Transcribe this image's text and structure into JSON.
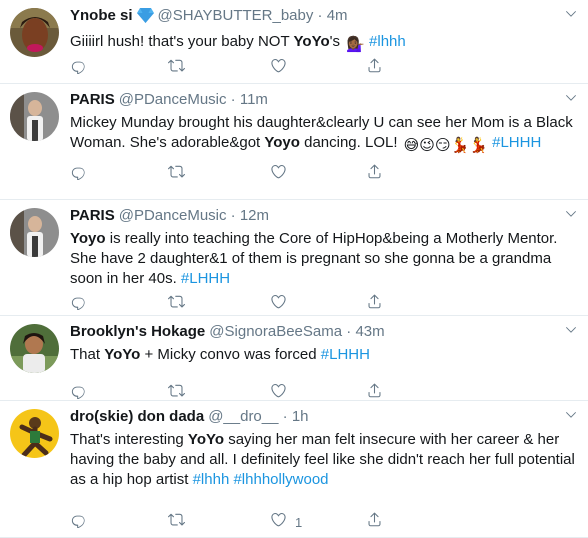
{
  "tweets": [
    {
      "name": "Ynobe si",
      "verified_badge": "diamond-emoji",
      "handle": "@SHAYBUTTER_baby",
      "dot": "·",
      "time": "4m",
      "text_parts": [
        {
          "t": "Giiiirl hush! that's your baby NOT "
        },
        {
          "t": "YoYo",
          "style": "bold"
        },
        {
          "t": "'s "
        },
        {
          "t": "💁🏾‍♀️",
          "style": "emoji",
          "icon": "woman-tipping-hand-emoji"
        },
        {
          "t": " "
        },
        {
          "t": "#lhhh",
          "style": "hashtag"
        }
      ],
      "like_count": ""
    },
    {
      "name": "PARIS",
      "handle": "@PDanceMusic",
      "dot": "·",
      "time": "11m",
      "text_parts": [
        {
          "t": "Mickey Munday brought his daughter&clearly U can see her Mom is a Black Woman. She's adorable&got "
        },
        {
          "t": "Yoyo",
          "style": "bold"
        },
        {
          "t": " dancing. LOL! "
        },
        {
          "t": "😅😉😏💃💃",
          "style": "emoji",
          "icon": "emoji-sweat-smile-wink-smirk-dancer-dancer"
        },
        {
          "t": " "
        },
        {
          "t": "#LHHH",
          "style": "hashtag"
        }
      ],
      "like_count": ""
    },
    {
      "name": "PARIS",
      "handle": "@PDanceMusic",
      "dot": "·",
      "time": "12m",
      "text_parts": [
        {
          "t": "Yoyo",
          "style": "bold"
        },
        {
          "t": " is really into teaching the Core of HipHop&being a Motherly Mentor. She have 2 daughter&1 of them is pregnant so she gonna be a grandma soon in her 40s. "
        },
        {
          "t": "#LHHH",
          "style": "hashtag"
        }
      ],
      "like_count": ""
    },
    {
      "name": "Brooklyn's Hokage",
      "handle": "@SignoraBeeSama",
      "dot": "·",
      "time": "43m",
      "text_parts": [
        {
          "t": "That "
        },
        {
          "t": "YoYo",
          "style": "bold"
        },
        {
          "t": " + Micky convo was forced "
        },
        {
          "t": "#LHHH",
          "style": "hashtag"
        }
      ],
      "like_count": ""
    },
    {
      "name": "dro(skie) don dada",
      "handle": "@__dro__",
      "dot": "·",
      "time": "1h",
      "text_parts": [
        {
          "t": "That's interesting "
        },
        {
          "t": "YoYo",
          "style": "bold"
        },
        {
          "t": " saying her man felt insecure with her career & her having the baby and all. I definitely feel like she didn't reach her full potential as a hip hop artist "
        },
        {
          "t": "#lhhh",
          "style": "hashtag"
        },
        {
          "t": " "
        },
        {
          "t": "#lhhhollywood",
          "style": "hashtag"
        }
      ],
      "like_count": "1"
    }
  ],
  "icons": {
    "reply": "reply-icon",
    "retweet": "retweet-icon",
    "like": "heart-icon",
    "share": "share-icon",
    "menu": "chevron-down-icon"
  },
  "colors": {
    "hashtag": "#1b95e0",
    "secondary_text": "#657786",
    "divider": "#e6ecf0"
  }
}
